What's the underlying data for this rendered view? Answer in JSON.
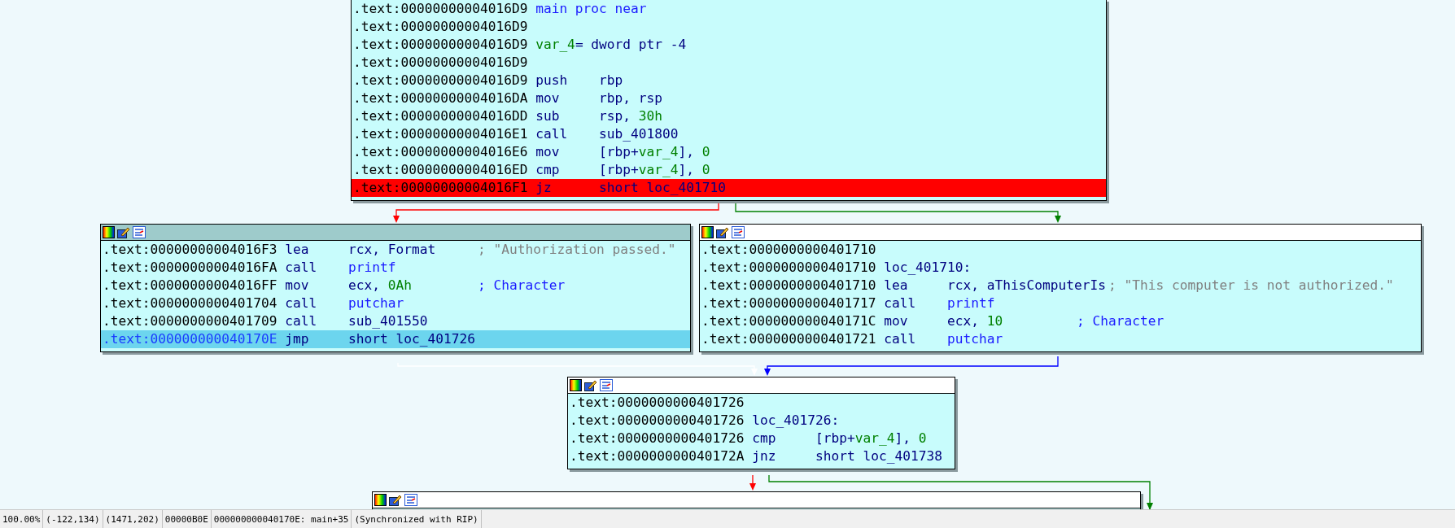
{
  "blocks": [
    {
      "lines": [
        {
          "address": ".text:00000000004016D9",
          "label": [
            {
              "text": "main proc near",
              "kind": "name"
            }
          ],
          "breakpoint": false,
          "selected": false
        },
        {
          "address": ".text:00000000004016D9",
          "breakpoint": false,
          "selected": false
        },
        {
          "address": ".text:00000000004016D9",
          "label": [
            {
              "text": "var_4",
              "kind": "var"
            },
            {
              "text": "= dword ptr -4",
              "kind": "reg"
            }
          ],
          "breakpoint": false,
          "selected": false
        },
        {
          "address": ".text:00000000004016D9",
          "breakpoint": false,
          "selected": false
        },
        {
          "address": ".text:00000000004016D9",
          "mnemonic": "push",
          "operands": [
            {
              "text": "rbp",
              "kind": "reg"
            }
          ],
          "breakpoint": false,
          "selected": false
        },
        {
          "address": ".text:00000000004016DA",
          "mnemonic": "mov",
          "operands": [
            {
              "text": "rbp, rsp",
              "kind": "reg"
            }
          ],
          "breakpoint": false,
          "selected": false
        },
        {
          "address": ".text:00000000004016DD",
          "mnemonic": "sub",
          "operands": [
            {
              "text": "rsp, ",
              "kind": "reg"
            },
            {
              "text": "30h",
              "kind": "num"
            }
          ],
          "breakpoint": false,
          "selected": false
        },
        {
          "address": ".text:00000000004016E1",
          "mnemonic": "call",
          "operands": [
            {
              "text": "sub_401800",
              "kind": "reg"
            }
          ],
          "breakpoint": false,
          "selected": false
        },
        {
          "address": ".text:00000000004016E6",
          "mnemonic": "mov",
          "operands": [
            {
              "text": "[rbp+",
              "kind": "reg"
            },
            {
              "text": "var_4",
              "kind": "var"
            },
            {
              "text": "], ",
              "kind": "reg"
            },
            {
              "text": "0",
              "kind": "num"
            }
          ],
          "breakpoint": false,
          "selected": false
        },
        {
          "address": ".text:00000000004016ED",
          "mnemonic": "cmp",
          "operands": [
            {
              "text": "[rbp+",
              "kind": "reg"
            },
            {
              "text": "var_4",
              "kind": "var"
            },
            {
              "text": "], ",
              "kind": "reg"
            },
            {
              "text": "0",
              "kind": "num"
            }
          ],
          "breakpoint": false,
          "selected": false
        },
        {
          "address": ".text:00000000004016F1",
          "mnemonic": "jz",
          "operands": [
            {
              "text": "short loc_401710",
              "kind": "reg"
            }
          ],
          "breakpoint": true,
          "selected": false
        }
      ]
    },
    {
      "active": true,
      "lines": [
        {
          "address": ".text:00000000004016F3",
          "mnemonic": "lea",
          "operands": [
            {
              "text": "rcx, Format",
              "kind": "reg"
            }
          ],
          "comment": {
            "text": "; \"Authorization passed.\"",
            "kind": "string"
          },
          "breakpoint": false,
          "selected": false
        },
        {
          "address": ".text:00000000004016FA",
          "mnemonic": "call",
          "operands": [
            {
              "text": "printf",
              "kind": "name"
            }
          ],
          "breakpoint": false,
          "selected": false
        },
        {
          "address": ".text:00000000004016FF",
          "mnemonic": "mov",
          "operands": [
            {
              "text": "ecx, ",
              "kind": "reg"
            },
            {
              "text": "0Ah",
              "kind": "num"
            }
          ],
          "comment": {
            "text": "; Character",
            "kind": "name"
          },
          "breakpoint": false,
          "selected": false
        },
        {
          "address": ".text:0000000000401704",
          "mnemonic": "call",
          "operands": [
            {
              "text": "putchar",
              "kind": "name"
            }
          ],
          "breakpoint": false,
          "selected": false
        },
        {
          "address": ".text:0000000000401709",
          "mnemonic": "call",
          "operands": [
            {
              "text": "sub_401550",
              "kind": "reg"
            }
          ],
          "breakpoint": false,
          "selected": false
        },
        {
          "address": ".text:000000000040170E",
          "mnemonic": "jmp",
          "operands": [
            {
              "text": "short loc_401726",
              "kind": "reg"
            }
          ],
          "breakpoint": false,
          "selected": true
        }
      ]
    },
    {
      "active": false,
      "lines": [
        {
          "address": ".text:0000000000401710",
          "breakpoint": false,
          "selected": false
        },
        {
          "address": ".text:0000000000401710",
          "label": [
            {
              "text": "loc_401710:",
              "kind": "reg"
            }
          ],
          "breakpoint": false,
          "selected": false
        },
        {
          "address": ".text:0000000000401710",
          "mnemonic": "lea",
          "operands": [
            {
              "text": "rcx, aThisComputerIs",
              "kind": "reg"
            }
          ],
          "comment": {
            "text": "; \"This computer is not authorized.\"",
            "kind": "string"
          },
          "breakpoint": false,
          "selected": false
        },
        {
          "address": ".text:0000000000401717",
          "mnemonic": "call",
          "operands": [
            {
              "text": "printf",
              "kind": "name"
            }
          ],
          "breakpoint": false,
          "selected": false
        },
        {
          "address": ".text:000000000040171C",
          "mnemonic": "mov",
          "operands": [
            {
              "text": "ecx, ",
              "kind": "reg"
            },
            {
              "text": "10",
              "kind": "num"
            }
          ],
          "comment": {
            "text": "; Character",
            "kind": "name"
          },
          "breakpoint": false,
          "selected": false
        },
        {
          "address": ".text:0000000000401721",
          "mnemonic": "call",
          "operands": [
            {
              "text": "putchar",
              "kind": "name"
            }
          ],
          "breakpoint": false,
          "selected": false
        }
      ]
    },
    {
      "active": false,
      "lines": [
        {
          "address": ".text:0000000000401726",
          "breakpoint": false,
          "selected": false
        },
        {
          "address": ".text:0000000000401726",
          "label": [
            {
              "text": "loc_401726:",
              "kind": "reg"
            }
          ],
          "breakpoint": false,
          "selected": false
        },
        {
          "address": ".text:0000000000401726",
          "mnemonic": "cmp",
          "operands": [
            {
              "text": "[rbp+",
              "kind": "reg"
            },
            {
              "text": "var_4",
              "kind": "var"
            },
            {
              "text": "], ",
              "kind": "reg"
            },
            {
              "text": "0",
              "kind": "num"
            }
          ],
          "breakpoint": false,
          "selected": false
        },
        {
          "address": ".text:000000000040172A",
          "mnemonic": "jnz",
          "operands": [
            {
              "text": "short loc_401738",
              "kind": "reg"
            }
          ],
          "breakpoint": false,
          "selected": false
        }
      ]
    },
    {
      "active": false
    }
  ],
  "status_bar": [
    "100.00%",
    "(-122,134)",
    "(1471,202)",
    "00000B0E",
    "000000000040170E: main+35",
    "(Synchronized with RIP)"
  ]
}
